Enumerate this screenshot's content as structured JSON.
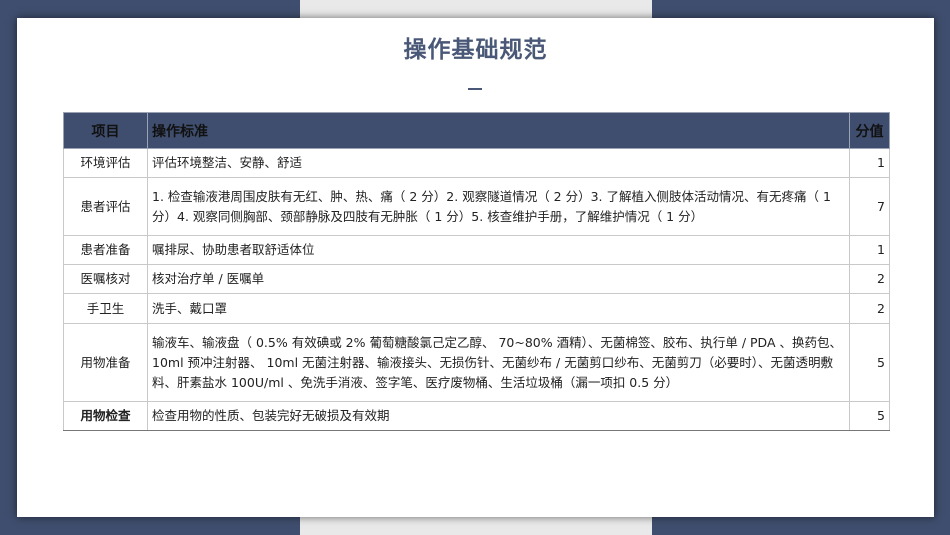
{
  "title": "操作基础规范",
  "title_mark": "—",
  "table": {
    "headers": {
      "item": "项目",
      "standard": "操作标准",
      "score": "分值"
    },
    "rows": [
      {
        "item": "环境评估",
        "standard": "评估环境整洁、安静、舒适",
        "score": "1"
      },
      {
        "item": "患者评估",
        "standard": "1. 检查输液港周围皮肤有无红、肿、热、痛（ 2 分）2. 观察隧道情况（ 2 分）3. 了解植入侧肢体活动情况、有无疼痛（ 1 分）4. 观察同侧胸部、颈部静脉及四肢有无肿胀（ 1 分）5. 核查维护手册，了解维护情况（ 1 分）",
        "score": "7"
      },
      {
        "item": "患者准备",
        "standard": "嘱排尿、协助患者取舒适体位",
        "score": "1"
      },
      {
        "item": "医嘱核对",
        "standard": "核对治疗单 / 医嘱单",
        "score": "2"
      },
      {
        "item": "手卫生",
        "standard": "洗手、戴口罩",
        "score": "2"
      },
      {
        "item": "用物准备",
        "standard": "输液车、输液盘（ 0.5% 有效碘或 2% 葡萄糖酸氯己定乙醇、 70~80% 酒精）、无菌棉签、胶布、执行单 / PDA 、换药包、 10ml 预冲注射器、 10ml 无菌注射器、输液接头、无损伤针、无菌纱布 / 无菌剪口纱布、无菌剪刀（必要时）、无菌透明敷料、肝素盐水 100U/ml 、免洗手消液、签字笔、医疗废物桶、生活垃圾桶（漏一项扣 0.5 分）",
        "score": "5"
      },
      {
        "item": "用物检查",
        "standard": "检查用物的性质、包装完好无破损及有效期",
        "score": "5"
      }
    ]
  },
  "colors": {
    "header_bg": "#3f4e6e",
    "side_band": "#3f4e6e",
    "title": "#4a5877"
  }
}
